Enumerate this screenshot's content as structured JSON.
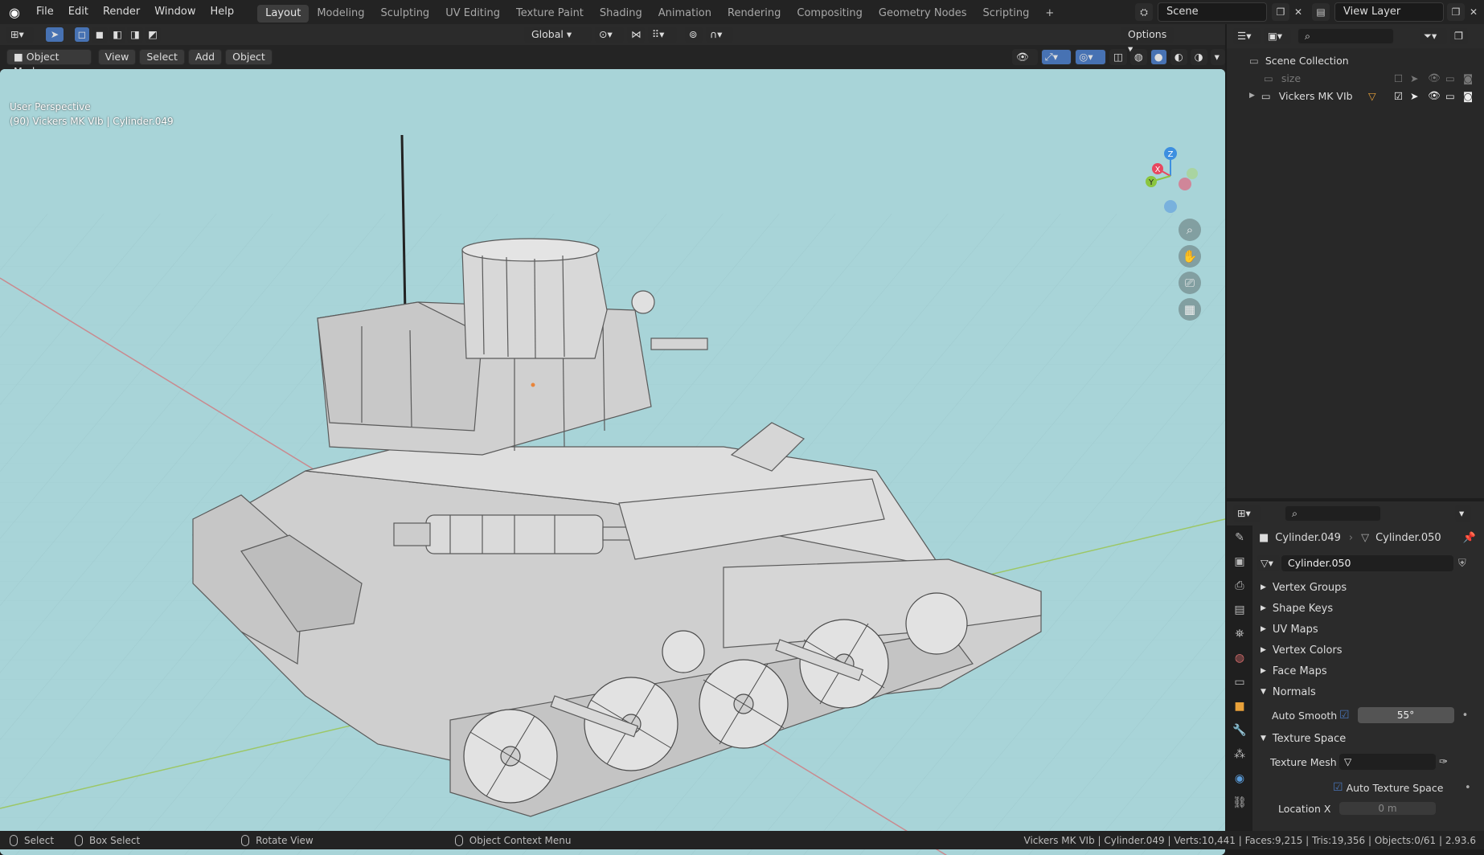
{
  "menu": [
    "File",
    "Edit",
    "Render",
    "Window",
    "Help"
  ],
  "workspaces": [
    "Layout",
    "Modeling",
    "Sculpting",
    "UV Editing",
    "Texture Paint",
    "Shading",
    "Animation",
    "Rendering",
    "Compositing",
    "Geometry Nodes",
    "Scripting"
  ],
  "active_workspace": "Layout",
  "scene": "Scene",
  "view_layer": "View Layer",
  "viewport": {
    "orientation": "Global",
    "options": "Options",
    "mode": "Object Mode",
    "view": "View",
    "select": "Select",
    "add": "Add",
    "object": "Object",
    "info_line1": "User Perspective",
    "info_line2": "(90) Vickers MK VIb | Cylinder.049",
    "axis_x": "X",
    "axis_y": "Y",
    "axis_z": "Z"
  },
  "outliner": {
    "root": "Scene Collection",
    "items": [
      {
        "label": "size",
        "dim": true
      },
      {
        "label": "Vickers MK VIb",
        "dim": false
      }
    ]
  },
  "properties": {
    "object_name": "Cylinder.049",
    "mesh_name": "Cylinder.050",
    "data_block": "Cylinder.050",
    "sections": [
      {
        "label": "Vertex Groups",
        "open": false
      },
      {
        "label": "Shape Keys",
        "open": false
      },
      {
        "label": "UV Maps",
        "open": false
      },
      {
        "label": "Vertex Colors",
        "open": false
      },
      {
        "label": "Face Maps",
        "open": false
      },
      {
        "label": "Normals",
        "open": true
      }
    ],
    "auto_smooth_label": "Auto Smooth",
    "auto_smooth_angle": "55°",
    "texture_space_label": "Texture Space",
    "texture_mesh_label": "Texture Mesh",
    "auto_texture_space_label": "Auto Texture Space",
    "location_x_label": "Location X",
    "location_x_value": "0 m"
  },
  "status": {
    "select": "Select",
    "box_select": "Box Select",
    "rotate_view": "Rotate View",
    "context_menu": "Object Context Menu",
    "stats": "Vickers MK VIb | Cylinder.049 | Verts:10,441 | Faces:9,215 | Tris:19,356 | Objects:0/61 | 2.93.6"
  },
  "colors": {
    "viewport_bg": "#a8d4d8",
    "accent": "#4772b3",
    "axis_x": "#e8475f",
    "axis_y": "#8bc53f",
    "axis_z": "#3d8fe0"
  }
}
